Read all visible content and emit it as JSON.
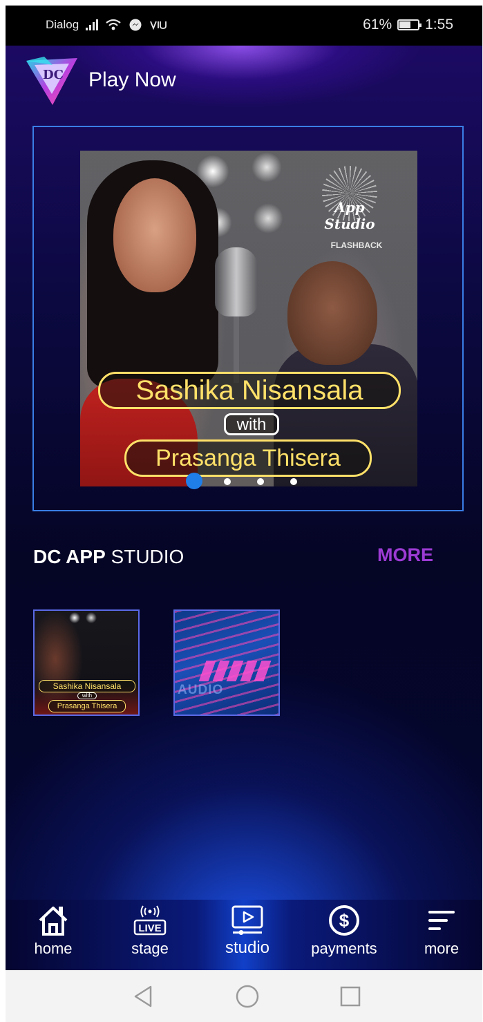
{
  "status_bar": {
    "carrier": "Dialog",
    "battery": "61%",
    "battery_level": 0.61,
    "time": "1:55",
    "icons": [
      "signal-icon",
      "wifi-icon",
      "messenger-icon",
      "network-icon"
    ]
  },
  "header": {
    "logo_text": "DC",
    "title": "Play Now"
  },
  "banner": {
    "badge_text": "App Studio",
    "badge_sub": "FLASHBACK",
    "caption_line1": "Sashika Nisansala",
    "caption_line2": "with",
    "caption_line3": "Prasanga Thisera",
    "dot_count": 4,
    "active_dot": 0
  },
  "section": {
    "title_bold": "DC APP",
    "title_rest": " STUDIO",
    "more": "MORE",
    "thumbnails": [
      {
        "line1": "Sashika Nisansala",
        "line2": "with",
        "line3": "Prasanga Thisera"
      },
      {
        "text": "AUDIO"
      }
    ]
  },
  "bottom_nav": {
    "items": [
      {
        "label": "home",
        "icon": "home-icon"
      },
      {
        "label": "stage",
        "icon": "live-icon"
      },
      {
        "label": "studio",
        "icon": "play-screen-icon",
        "active": true
      },
      {
        "label": "payments",
        "icon": "dollar-icon"
      },
      {
        "label": "more",
        "icon": "menu-lines-icon"
      }
    ]
  },
  "system_nav": [
    "back-icon",
    "home-circle-icon",
    "recents-icon"
  ],
  "colors": {
    "accent_blue": "#1f7ee8",
    "more_purple": "#9d3bd4",
    "caption_yellow": "#ffe169",
    "frame_blue": "#3a7ee6"
  }
}
